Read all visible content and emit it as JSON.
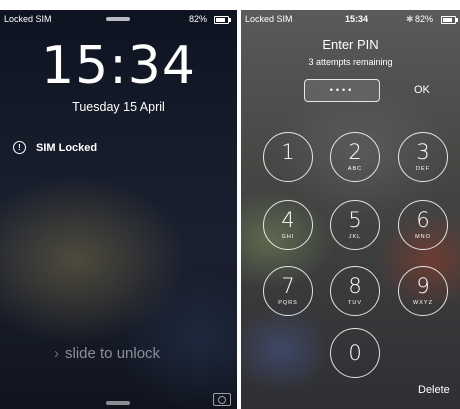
{
  "lock_screen": {
    "carrier": "Locked SIM",
    "battery": "82%",
    "time": "15:34",
    "date": "Tuesday 15 April",
    "notification": "SIM Locked",
    "slide_text": "slide to unlock",
    "icons": {
      "notification": "alert-circle-icon",
      "camera": "camera-icon",
      "chevron": "chevron-right-icon"
    }
  },
  "pin_screen": {
    "carrier": "Locked SIM",
    "time": "15:34",
    "battery": "82%",
    "title": "Enter PIN",
    "attempts": "3 attempts remaining",
    "pin_dots": "••••",
    "ok_label": "OK",
    "delete_label": "Delete",
    "keys": [
      {
        "num": "1",
        "letters": ""
      },
      {
        "num": "2",
        "letters": "ABC"
      },
      {
        "num": "3",
        "letters": "DEF"
      },
      {
        "num": "4",
        "letters": "GHI"
      },
      {
        "num": "5",
        "letters": "JKL"
      },
      {
        "num": "6",
        "letters": "MNO"
      },
      {
        "num": "7",
        "letters": "PQRS"
      },
      {
        "num": "8",
        "letters": "TUV"
      },
      {
        "num": "9",
        "letters": "WXYZ"
      },
      {
        "num": "0",
        "letters": ""
      }
    ]
  }
}
